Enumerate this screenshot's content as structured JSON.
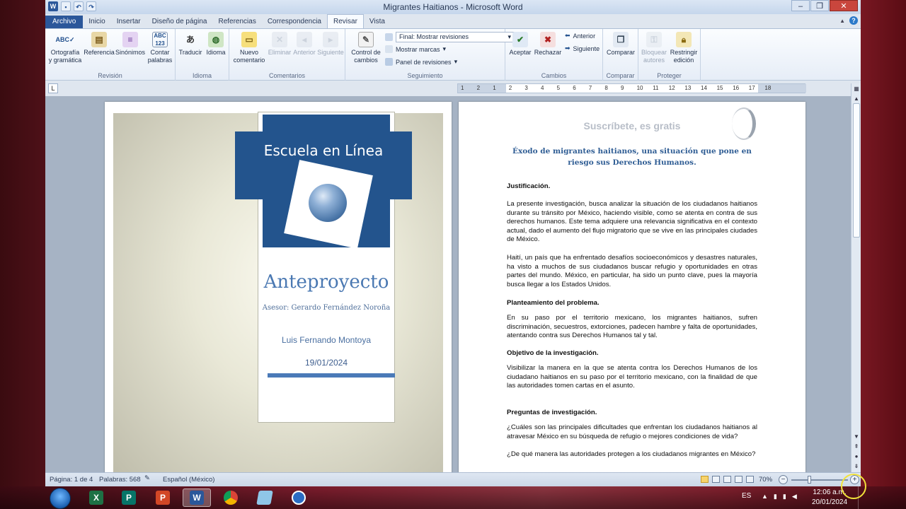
{
  "window": {
    "title": "Migrantes Haitianos - Microsoft Word",
    "quick_access": [
      "W",
      "save",
      "undo",
      "redo"
    ],
    "controls": [
      "–",
      "❐",
      "✕"
    ]
  },
  "tabs": [
    {
      "label": "Archivo"
    },
    {
      "label": "Inicio"
    },
    {
      "label": "Insertar"
    },
    {
      "label": "Diseño de página"
    },
    {
      "label": "Referencias"
    },
    {
      "label": "Correspondencia"
    },
    {
      "label": "Revisar"
    },
    {
      "label": "Vista"
    }
  ],
  "ribbon": {
    "revision": {
      "label": "Revisión",
      "buttons": [
        "Ortografía\ny gramática",
        "Referencia",
        "Sinónimos",
        "Contar\npalabras"
      ]
    },
    "idioma": {
      "label": "Idioma",
      "buttons": [
        "Traducir",
        "Idioma"
      ]
    },
    "comentarios": {
      "label": "Comentarios",
      "buttons": [
        "Nuevo\ncomentario",
        "Eliminar",
        "Anterior",
        "Siguiente"
      ]
    },
    "seguimiento": {
      "label": "Seguimiento",
      "control": "Control de\ncambios",
      "display_select": "Final: Mostrar revisiones",
      "show_markup": "Mostrar marcas",
      "review_pane": "Panel de revisiones"
    },
    "cambios": {
      "label": "Cambios",
      "accept": "Aceptar",
      "reject": "Rechazar",
      "previous": "Anterior",
      "next": "Siguiente"
    },
    "comparar": {
      "label": "Comparar",
      "compare": "Comparar"
    },
    "proteger": {
      "label": "Proteger",
      "block": "Bloquear\nautores",
      "restrict": "Restringir\nedición"
    }
  },
  "ruler": {
    "labels": [
      "1",
      "2",
      "1",
      "2",
      "3",
      "4",
      "5",
      "6",
      "7",
      "8",
      "9",
      "10",
      "11",
      "12",
      "13",
      "14",
      "15",
      "16",
      "17",
      "18"
    ]
  },
  "cover": {
    "school": "Escuela en Línea",
    "title": "Anteproyecto",
    "advisor": "Asesor: Gerardo Fernández Noroña",
    "author": "Luis Fernando Montoya",
    "date": "19/01/2024"
  },
  "page2": {
    "subscribe": "Suscríbete, es gratis",
    "title": "Éxodo de migrantes haitianos, una situación que pone en riesgo sus Derechos Humanos.",
    "justificacion_head": "Justificación.",
    "justificacion_p1": "La presente investigación, busca analizar la situación de los ciudadanos haitianos durante su tránsito por México, haciendo visible, como se atenta en contra de sus derechos humanos. Este tema adquiere una relevancia significativa en el contexto actual, dado el aumento del flujo migratorio que se vive en las principales ciudades de México.",
    "justificacion_p2": "Haití, un país que ha enfrentado desafíos socioeconómicos y desastres naturales, ha visto a muchos de sus ciudadanos buscar refugio y oportunidades en otras partes del mundo. México, en particular, ha sido un punto clave, pues la mayoría busca llegar a los Estados Unidos.",
    "planteamiento_head": "Planteamiento del problema.",
    "planteamiento_p": "En su paso por el territorio mexicano, los migrantes haitianos, sufren discriminación, secuestros, extorciones, padecen hambre y falta de oportunidades, atentando contra sus Derechos Humanos tal y tal.",
    "objetivo_head": "Objetivo de la investigación.",
    "objetivo_p": "Visibilizar la manera en la que se atenta contra los Derechos Humanos de los ciudadano haitianos en su paso por el territorio mexicano, con la finalidad de que las autoridades tomen cartas en el asunto.",
    "preguntas_head": "Preguntas de investigación.",
    "pregunta1": "¿Cuáles son las principales dificultades que enfrentan los ciudadanos haitianos al atravesar México en su búsqueda de refugio o mejores condiciones de vida?",
    "pregunta2": "¿De qué manera las autoridades protegen a los ciudadanos migrantes en México?"
  },
  "status": {
    "page": "Página: 1 de 4",
    "words": "Palabras: 568",
    "language": "Español (México)",
    "zoom": "70%",
    "zoom_value": 0.7
  },
  "taskbar": {
    "apps": [
      "excel-icon",
      "publisher-icon",
      "powerpoint-icon",
      "word-icon",
      "chrome-icon",
      "notes-icon",
      "app-icon"
    ],
    "lang": "ES",
    "time": "12:06 a.m.",
    "date": "20/01/2024"
  },
  "colors": {
    "accent": "#2b579a",
    "cover_blue": "#23548d",
    "title_blue": "#2f5d94"
  }
}
